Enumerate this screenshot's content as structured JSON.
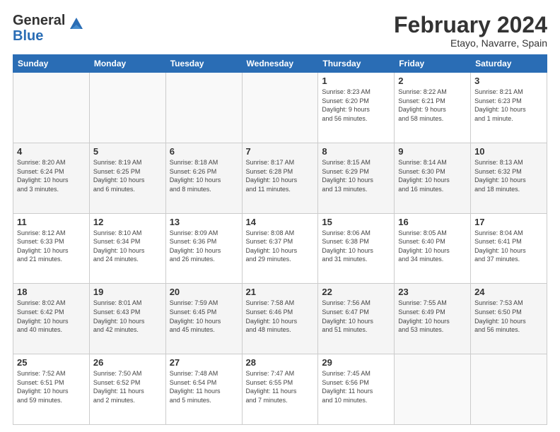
{
  "logo": {
    "line1": "General",
    "line2": "Blue"
  },
  "title": "February 2024",
  "subtitle": "Etayo, Navarre, Spain",
  "days_header": [
    "Sunday",
    "Monday",
    "Tuesday",
    "Wednesday",
    "Thursday",
    "Friday",
    "Saturday"
  ],
  "weeks": [
    [
      {
        "day": "",
        "info": ""
      },
      {
        "day": "",
        "info": ""
      },
      {
        "day": "",
        "info": ""
      },
      {
        "day": "",
        "info": ""
      },
      {
        "day": "1",
        "info": "Sunrise: 8:23 AM\nSunset: 6:20 PM\nDaylight: 9 hours\nand 56 minutes."
      },
      {
        "day": "2",
        "info": "Sunrise: 8:22 AM\nSunset: 6:21 PM\nDaylight: 9 hours\nand 58 minutes."
      },
      {
        "day": "3",
        "info": "Sunrise: 8:21 AM\nSunset: 6:23 PM\nDaylight: 10 hours\nand 1 minute."
      }
    ],
    [
      {
        "day": "4",
        "info": "Sunrise: 8:20 AM\nSunset: 6:24 PM\nDaylight: 10 hours\nand 3 minutes."
      },
      {
        "day": "5",
        "info": "Sunrise: 8:19 AM\nSunset: 6:25 PM\nDaylight: 10 hours\nand 6 minutes."
      },
      {
        "day": "6",
        "info": "Sunrise: 8:18 AM\nSunset: 6:26 PM\nDaylight: 10 hours\nand 8 minutes."
      },
      {
        "day": "7",
        "info": "Sunrise: 8:17 AM\nSunset: 6:28 PM\nDaylight: 10 hours\nand 11 minutes."
      },
      {
        "day": "8",
        "info": "Sunrise: 8:15 AM\nSunset: 6:29 PM\nDaylight: 10 hours\nand 13 minutes."
      },
      {
        "day": "9",
        "info": "Sunrise: 8:14 AM\nSunset: 6:30 PM\nDaylight: 10 hours\nand 16 minutes."
      },
      {
        "day": "10",
        "info": "Sunrise: 8:13 AM\nSunset: 6:32 PM\nDaylight: 10 hours\nand 18 minutes."
      }
    ],
    [
      {
        "day": "11",
        "info": "Sunrise: 8:12 AM\nSunset: 6:33 PM\nDaylight: 10 hours\nand 21 minutes."
      },
      {
        "day": "12",
        "info": "Sunrise: 8:10 AM\nSunset: 6:34 PM\nDaylight: 10 hours\nand 24 minutes."
      },
      {
        "day": "13",
        "info": "Sunrise: 8:09 AM\nSunset: 6:36 PM\nDaylight: 10 hours\nand 26 minutes."
      },
      {
        "day": "14",
        "info": "Sunrise: 8:08 AM\nSunset: 6:37 PM\nDaylight: 10 hours\nand 29 minutes."
      },
      {
        "day": "15",
        "info": "Sunrise: 8:06 AM\nSunset: 6:38 PM\nDaylight: 10 hours\nand 31 minutes."
      },
      {
        "day": "16",
        "info": "Sunrise: 8:05 AM\nSunset: 6:40 PM\nDaylight: 10 hours\nand 34 minutes."
      },
      {
        "day": "17",
        "info": "Sunrise: 8:04 AM\nSunset: 6:41 PM\nDaylight: 10 hours\nand 37 minutes."
      }
    ],
    [
      {
        "day": "18",
        "info": "Sunrise: 8:02 AM\nSunset: 6:42 PM\nDaylight: 10 hours\nand 40 minutes."
      },
      {
        "day": "19",
        "info": "Sunrise: 8:01 AM\nSunset: 6:43 PM\nDaylight: 10 hours\nand 42 minutes."
      },
      {
        "day": "20",
        "info": "Sunrise: 7:59 AM\nSunset: 6:45 PM\nDaylight: 10 hours\nand 45 minutes."
      },
      {
        "day": "21",
        "info": "Sunrise: 7:58 AM\nSunset: 6:46 PM\nDaylight: 10 hours\nand 48 minutes."
      },
      {
        "day": "22",
        "info": "Sunrise: 7:56 AM\nSunset: 6:47 PM\nDaylight: 10 hours\nand 51 minutes."
      },
      {
        "day": "23",
        "info": "Sunrise: 7:55 AM\nSunset: 6:49 PM\nDaylight: 10 hours\nand 53 minutes."
      },
      {
        "day": "24",
        "info": "Sunrise: 7:53 AM\nSunset: 6:50 PM\nDaylight: 10 hours\nand 56 minutes."
      }
    ],
    [
      {
        "day": "25",
        "info": "Sunrise: 7:52 AM\nSunset: 6:51 PM\nDaylight: 10 hours\nand 59 minutes."
      },
      {
        "day": "26",
        "info": "Sunrise: 7:50 AM\nSunset: 6:52 PM\nDaylight: 11 hours\nand 2 minutes."
      },
      {
        "day": "27",
        "info": "Sunrise: 7:48 AM\nSunset: 6:54 PM\nDaylight: 11 hours\nand 5 minutes."
      },
      {
        "day": "28",
        "info": "Sunrise: 7:47 AM\nSunset: 6:55 PM\nDaylight: 11 hours\nand 7 minutes."
      },
      {
        "day": "29",
        "info": "Sunrise: 7:45 AM\nSunset: 6:56 PM\nDaylight: 11 hours\nand 10 minutes."
      },
      {
        "day": "",
        "info": ""
      },
      {
        "day": "",
        "info": ""
      }
    ]
  ]
}
